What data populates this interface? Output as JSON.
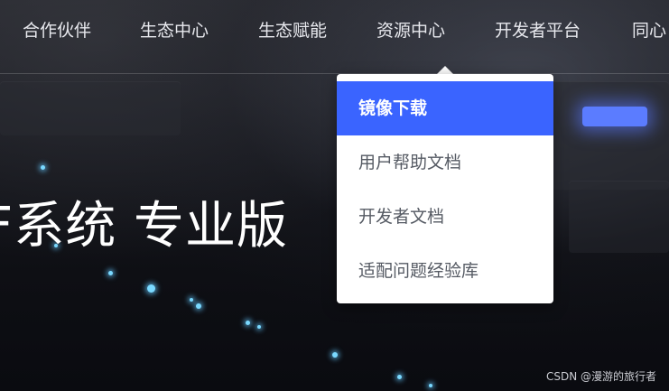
{
  "nav": {
    "items": [
      {
        "label": "合作伙伴"
      },
      {
        "label": "生态中心"
      },
      {
        "label": "生态赋能"
      },
      {
        "label": "资源中心"
      },
      {
        "label": "开发者平台"
      },
      {
        "label": "同心"
      }
    ]
  },
  "hero": {
    "title": "F系统 专业版"
  },
  "dropdown": {
    "items": [
      {
        "label": "镜像下载",
        "active": true
      },
      {
        "label": "用户帮助文档",
        "active": false
      },
      {
        "label": "开发者文档",
        "active": false
      },
      {
        "label": "适配问题经验库",
        "active": false
      }
    ]
  },
  "watermark": "CSDN @漫游的旅行者",
  "colors": {
    "accent": "#3a64ff",
    "menu_text": "#555a63",
    "nav_text": "#e8e9ee"
  }
}
